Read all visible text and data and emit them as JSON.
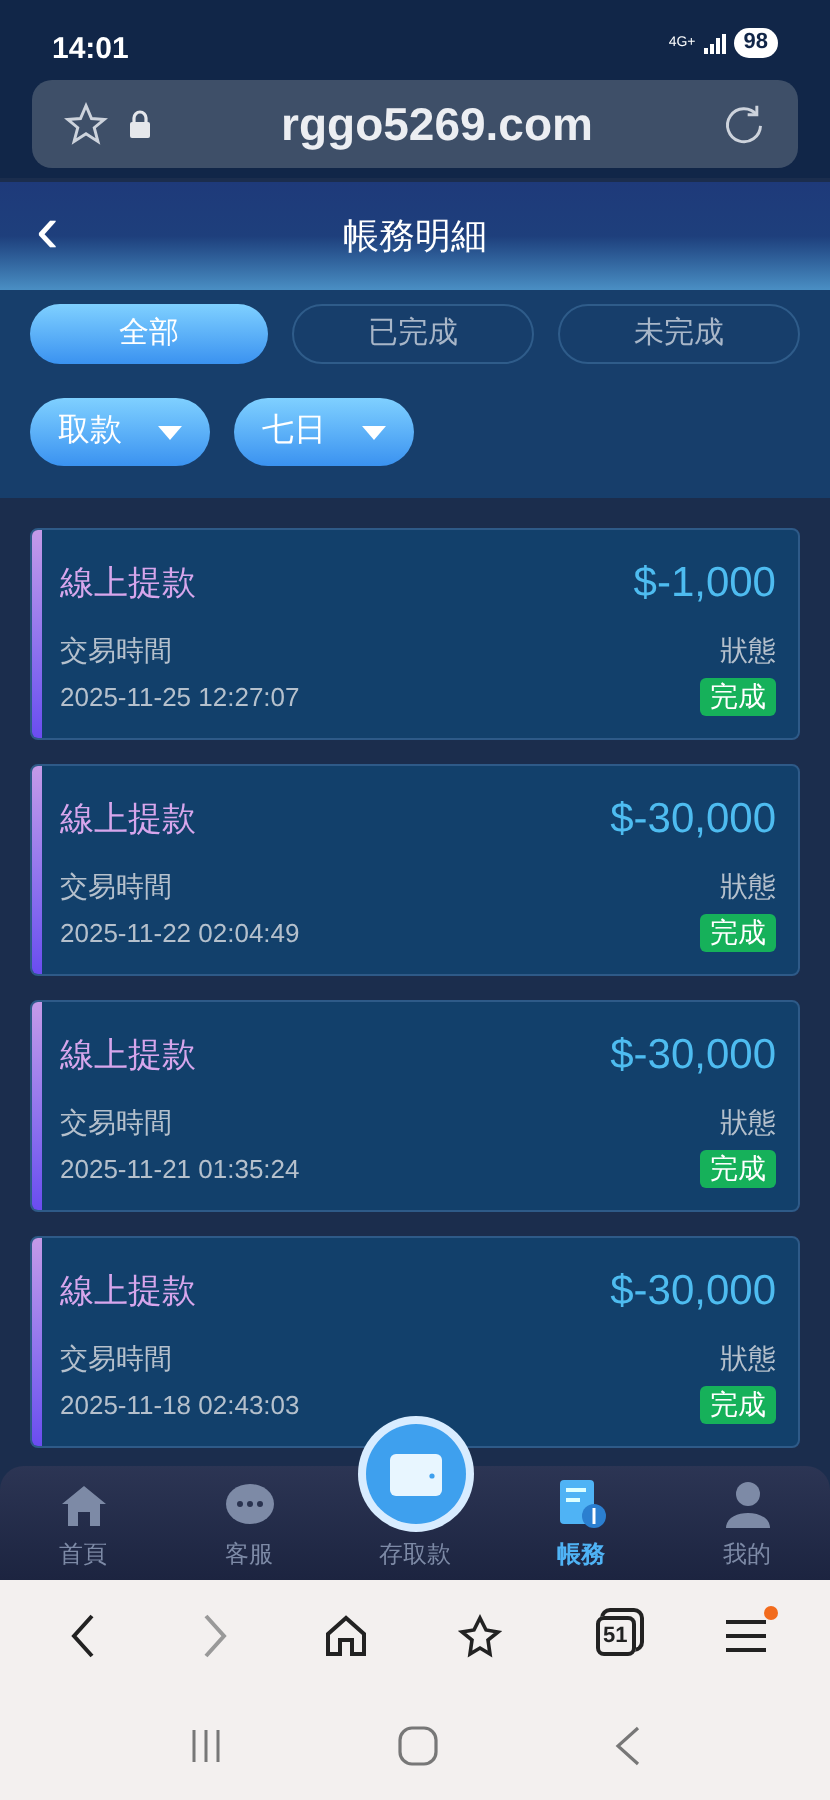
{
  "status_bar": {
    "time": "14:01",
    "network": "4G+",
    "battery": "98"
  },
  "address_bar": {
    "url": "rggo5269.com"
  },
  "header": {
    "back": "‹",
    "title": "帳務明細"
  },
  "tabs": [
    {
      "label": "全部",
      "selected": true
    },
    {
      "label": "已完成",
      "selected": false
    },
    {
      "label": "未完成",
      "selected": false
    }
  ],
  "filters": [
    {
      "label": "取款"
    },
    {
      "label": "七日"
    }
  ],
  "records": [
    {
      "title": "線上提款",
      "amount": "$-1,000",
      "time_label": "交易時間",
      "time": "2025-11-25 12:27:07",
      "status_label": "狀態",
      "status": "完成"
    },
    {
      "title": "線上提款",
      "amount": "$-30,000",
      "time_label": "交易時間",
      "time": "2025-11-22 02:04:49",
      "status_label": "狀態",
      "status": "完成"
    },
    {
      "title": "線上提款",
      "amount": "$-30,000",
      "time_label": "交易時間",
      "time": "2025-11-21 01:35:24",
      "status_label": "狀態",
      "status": "完成"
    },
    {
      "title": "線上提款",
      "amount": "$-30,000",
      "time_label": "交易時間",
      "time": "2025-11-18 02:43:03",
      "status_label": "狀態",
      "status": "完成"
    }
  ],
  "bottom_nav": [
    {
      "label": "首頁",
      "kind": "home",
      "selected": false
    },
    {
      "label": "客服",
      "kind": "chat",
      "selected": false
    },
    {
      "label": "存取款",
      "kind": "wallet",
      "selected": false
    },
    {
      "label": "帳務",
      "kind": "ledger",
      "selected": true
    },
    {
      "label": "我的",
      "kind": "profile",
      "selected": false
    }
  ],
  "browser_toolbar": {
    "tab_count": "51",
    "menu_badge": true
  }
}
